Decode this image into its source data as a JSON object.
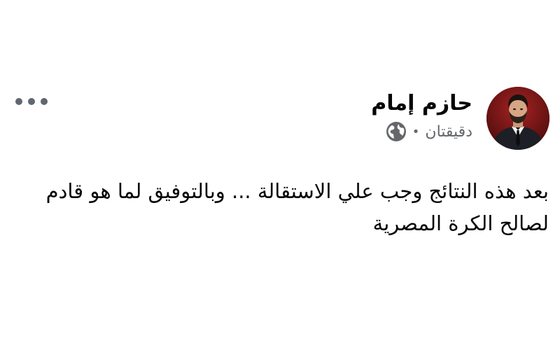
{
  "post": {
    "author": "حازم إمام",
    "timestamp": "دقيقتان",
    "separator": "•",
    "privacy_icon": "globe-icon",
    "more_icon": "more-options-icon",
    "text": "بعد هذه النتائج وجب علي الاستقالة ... وبالتوفيق لما هو قادم لصالح الكرة المصرية"
  },
  "colors": {
    "name": "#050505",
    "meta": "#65676b",
    "dots": "#606770",
    "avatar_bg": "#6a1414"
  }
}
